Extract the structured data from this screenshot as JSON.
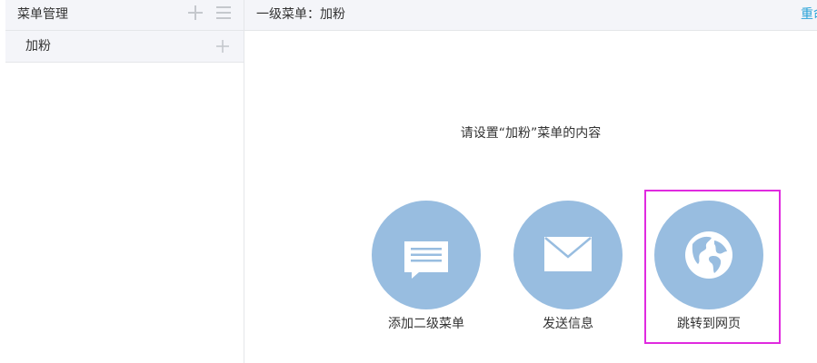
{
  "sidebar": {
    "title": "菜单管理",
    "add_icon": "plus-icon",
    "sort_icon": "list-icon",
    "items": [
      {
        "label": "加粉",
        "add_icon": "plus-icon"
      }
    ]
  },
  "content": {
    "header_title": "一级菜单：加粉",
    "header_link": "重命名",
    "prompt": "请设置“加粉”菜单的内容",
    "options": [
      {
        "label": "添加二级菜单",
        "icon": "message-icon"
      },
      {
        "label": "发送信息",
        "icon": "envelope-icon"
      },
      {
        "label": "跳转到网页",
        "icon": "globe-icon"
      }
    ]
  },
  "colors": {
    "icon_circle": "#98bde0",
    "header_bg": "#f4f5f9",
    "highlight": "#e02adf",
    "link": "#2aa3d8"
  }
}
